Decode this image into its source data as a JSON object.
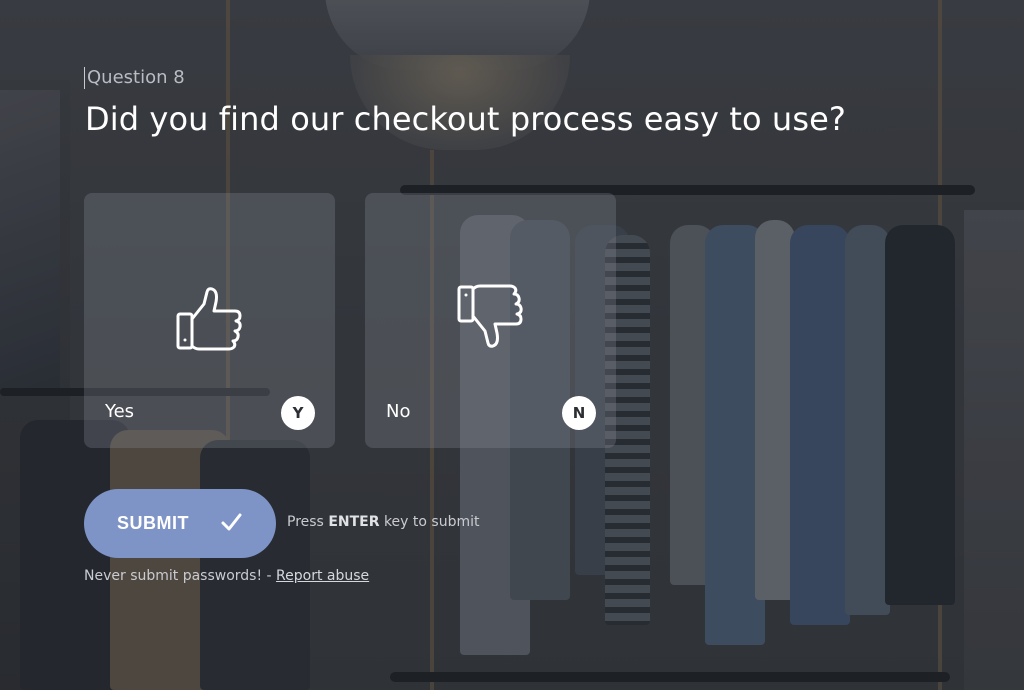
{
  "question": {
    "number_label": "Question 8",
    "title": "Did you find our checkout process easy to use?"
  },
  "choices": [
    {
      "label": "Yes",
      "key": "Y",
      "icon": "thumbs-up-icon"
    },
    {
      "label": "No",
      "key": "N",
      "icon": "thumbs-down-icon"
    }
  ],
  "submit": {
    "label": "SUBMIT",
    "icon": "checkmark-icon",
    "color": "#7e94c7",
    "hint_prefix": "Press",
    "hint_key": "ENTER",
    "hint_suffix": "key to submit"
  },
  "footer": {
    "warning": "Never submit passwords! -",
    "report_link": "Report abuse"
  }
}
